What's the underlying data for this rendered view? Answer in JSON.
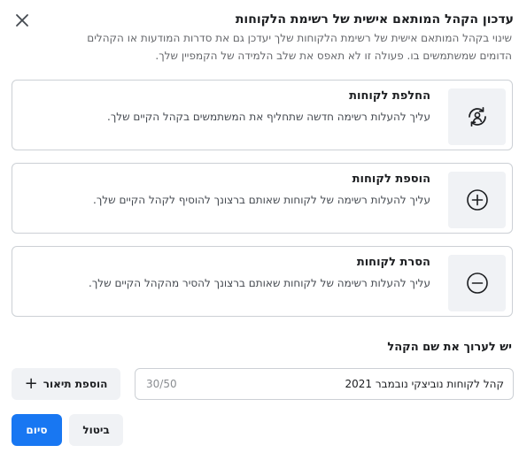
{
  "dialog": {
    "title": "עדכון הקהל המותאם אישית של רשימת הלקוחות",
    "subtitle": "שינוי בקהל המותאם אישית של רשימת הלקוחות שלך יעדכן גם את סדרות המודעות או הקהלים הדומים שמשתמשים בו. פעולה זו לא תאפס את שלב הלמידה של הקמפיין שלך."
  },
  "options": [
    {
      "title": "החלפת לקוחות",
      "description": "עליך להעלות רשימה חדשה שתחליף את המשתמשים בקהל הקיים שלך.",
      "icon": "replace-icon"
    },
    {
      "title": "הוספת לקוחות",
      "description": "עליך להעלות רשימה של לקוחות שאותם ברצונך להוסיף לקהל הקיים שלך.",
      "icon": "plus-circle-icon"
    },
    {
      "title": "הסרת לקוחות",
      "description": "עליך להעלות רשימה של לקוחות שאותם ברצונך להסיר מהקהל הקיים שלך.",
      "icon": "minus-circle-icon"
    }
  ],
  "name_section": {
    "label": "יש לערוך את שם הקהל",
    "value": "קהל לקוחות נוביצקי נובמבר 2021",
    "counter": "30/50",
    "add_description_label": "הוספת תיאור"
  },
  "footer": {
    "cancel_label": "ביטול",
    "finish_label": "סיום"
  },
  "colors": {
    "primary": "#1877f2",
    "surface": "#f0f2f5",
    "border": "#ccd0d5"
  }
}
